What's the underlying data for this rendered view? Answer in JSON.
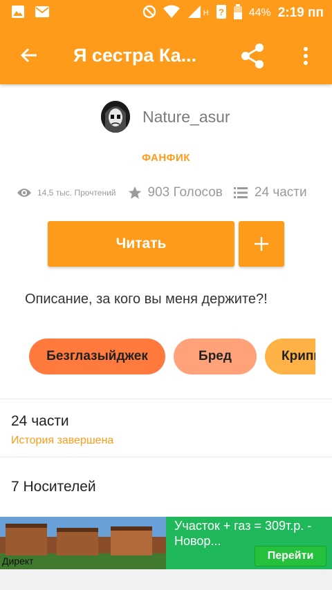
{
  "status_bar": {
    "battery_pct": "44%",
    "time": "2:19 пп",
    "network_label": "H"
  },
  "app_bar": {
    "title": "Я сестра  Ка..."
  },
  "story": {
    "author": "Nature_asur",
    "category": "ФАНФИК",
    "reads": "14,5 тыс. Прочтений",
    "votes": "903 Голосов",
    "parts": "24 части",
    "read_button": "Читать",
    "description": "Описание, за кого вы меня держите?!"
  },
  "tags": [
    {
      "label": "Безглазыйджек",
      "color": "#ff7a3c"
    },
    {
      "label": "Бред",
      "color": "#ffa27a"
    },
    {
      "label": "Крипи",
      "color": "#ffb347"
    }
  ],
  "parts_section": {
    "title": "24 части",
    "status": "История завершена"
  },
  "carriers": {
    "title": "7 Носителей"
  },
  "ad": {
    "label": "Директ",
    "text": "Участок + газ = 309т.р. - Новор...",
    "button": "Перейти"
  }
}
